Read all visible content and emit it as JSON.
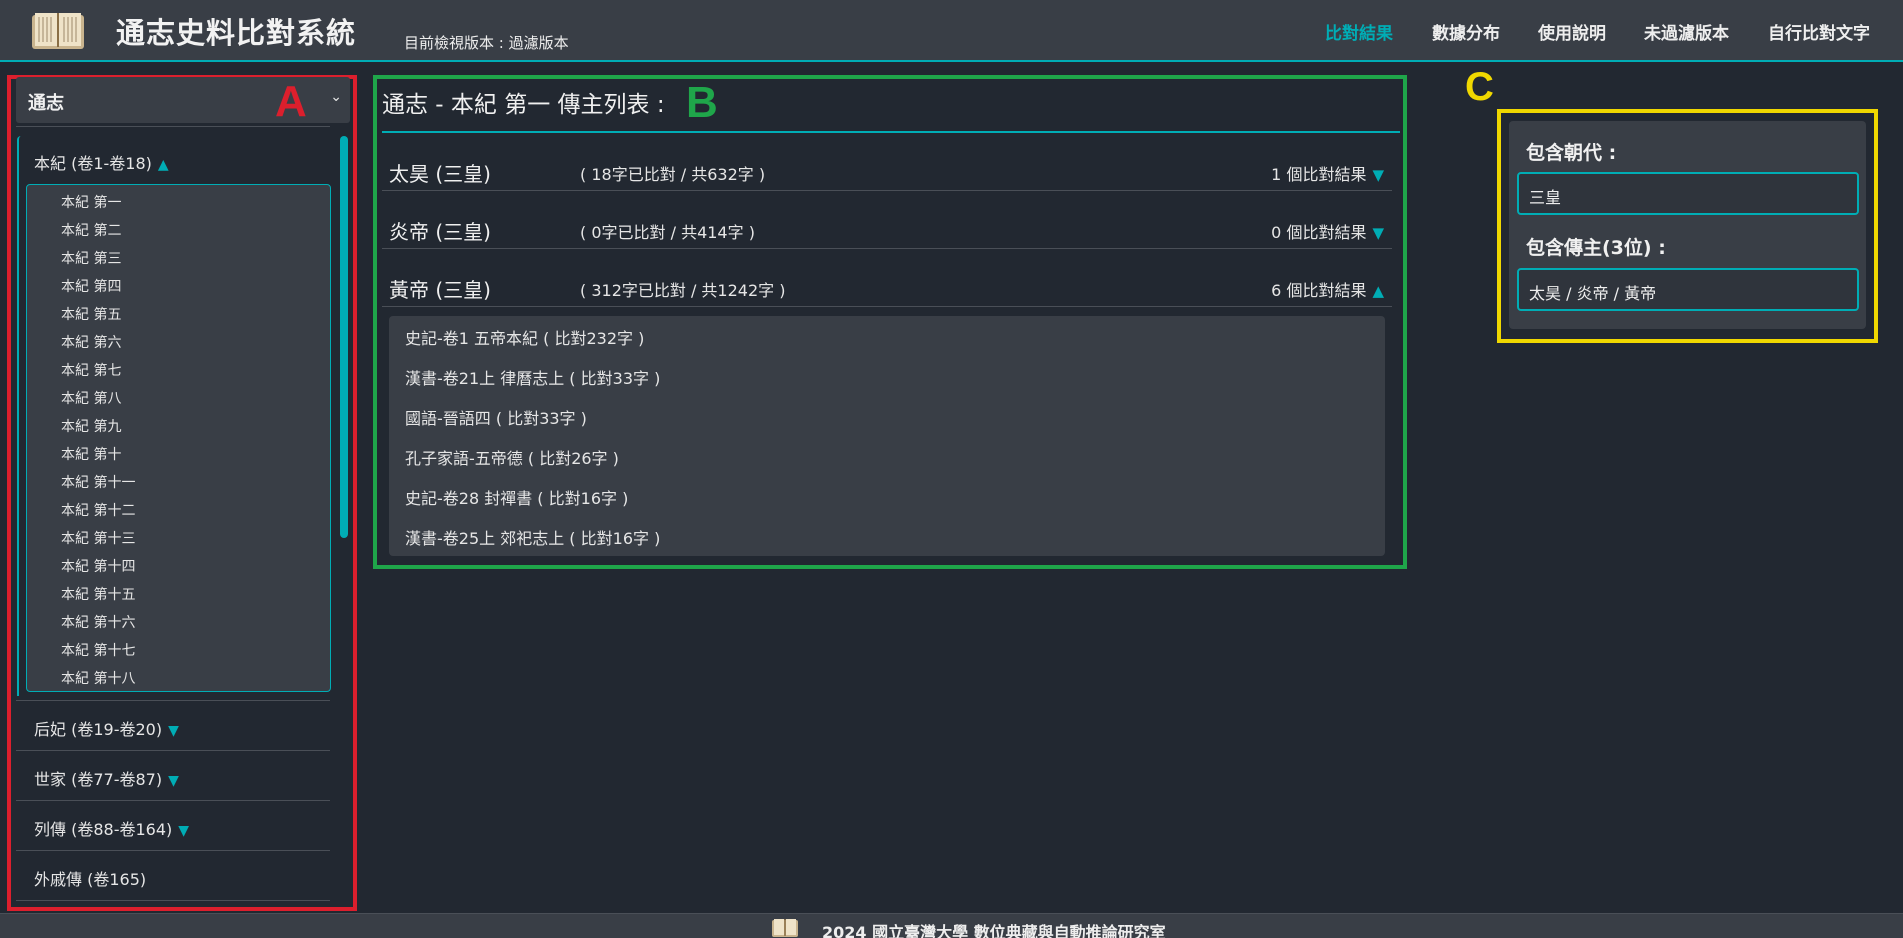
{
  "header": {
    "title": "通志史料比對系統",
    "version_label": "目前檢視版本 : 過濾版本",
    "nav": [
      "比對結果",
      "數據分布",
      "使用說明",
      "未過濾版本",
      "自行比對文字"
    ],
    "active_nav": "比對結果",
    "logo_icon": "book-logo-icon"
  },
  "panel_letters": {
    "a": "A",
    "b": "B",
    "c": "C"
  },
  "sidebar": {
    "selected_book": "通志",
    "open_section": "本紀 (卷1-卷18)",
    "chapters": [
      "本紀 第一",
      "本紀 第二",
      "本紀 第三",
      "本紀 第四",
      "本紀 第五",
      "本紀 第六",
      "本紀 第七",
      "本紀 第八",
      "本紀 第九",
      "本紀 第十",
      "本紀 第十一",
      "本紀 第十二",
      "本紀 第十三",
      "本紀 第十四",
      "本紀 第十五",
      "本紀 第十六",
      "本紀 第十七",
      "本紀 第十八"
    ],
    "sections": [
      {
        "label": "后妃 (卷19-卷20)",
        "has_toggle": true
      },
      {
        "label": "世家 (卷77-卷87)",
        "has_toggle": true
      },
      {
        "label": "列傳 (卷88-卷164)",
        "has_toggle": true
      },
      {
        "label": "外戚傳 (卷165)",
        "has_toggle": false
      }
    ]
  },
  "main": {
    "title": "通志 - 本紀 第一 傳主列表 :",
    "rows": [
      {
        "name": "太昊 (三皇)",
        "stats": "( 18字已比對 / 共632字 )",
        "count": "1 個比對結果",
        "expanded": false
      },
      {
        "name": "炎帝 (三皇)",
        "stats": "( 0字已比對 / 共414字 )",
        "count": "0 個比對結果",
        "expanded": false
      },
      {
        "name": "黃帝 (三皇)",
        "stats": "( 312字已比對 / 共1242字 )",
        "count": "6 個比對結果",
        "expanded": true
      }
    ],
    "results": [
      "史記-卷1 五帝本紀 ( 比對232字 )",
      "漢書-卷21上 律曆志上 ( 比對33字 )",
      "國語-晉語四 ( 比對33字 )",
      "孔子家語-五帝德 ( 比對26字 )",
      "史記-卷28 封禪書 ( 比對16字 )",
      "漢書-卷25上 郊祀志上 ( 比對16字 )"
    ]
  },
  "filters": {
    "dynasty_label": "包含朝代 :",
    "dynasty_value": "三皇",
    "person_label": "包含傳主(3位) :",
    "person_value": "太昊 / 炎帝 / 黃帝"
  },
  "footer": {
    "text": "2024 國立臺灣大學 數位典藏與自動推論研究室"
  },
  "colors": {
    "accent": "#00adb5",
    "panel_a": "#dc1f2d",
    "panel_b": "#1fa64a",
    "panel_c": "#f0d800"
  }
}
